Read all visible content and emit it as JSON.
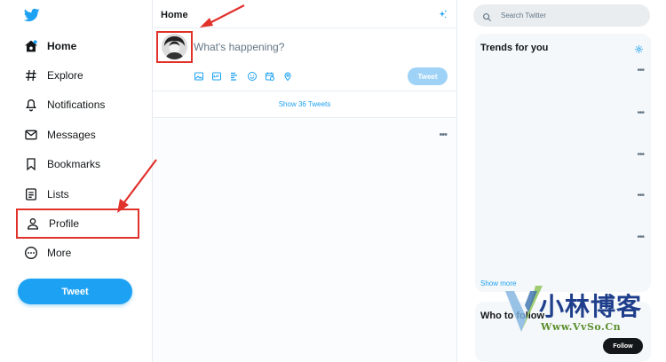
{
  "sidebar": {
    "logo": "twitter-bird-icon",
    "items": [
      {
        "label": "Home",
        "icon": "home-icon",
        "active": true
      },
      {
        "label": "Explore",
        "icon": "hashtag-icon",
        "active": false
      },
      {
        "label": "Notifications",
        "icon": "bell-icon",
        "active": false
      },
      {
        "label": "Messages",
        "icon": "envelope-icon",
        "active": false
      },
      {
        "label": "Bookmarks",
        "icon": "bookmark-icon",
        "active": false
      },
      {
        "label": "Lists",
        "icon": "list-icon",
        "active": false
      },
      {
        "label": "Profile",
        "icon": "person-icon",
        "active": false
      },
      {
        "label": "More",
        "icon": "more-circle-icon",
        "active": false
      }
    ],
    "tweet_button": "Tweet"
  },
  "main": {
    "title": "Home",
    "compose": {
      "placeholder": "What's happening?",
      "tweet_button": "Tweet"
    },
    "show_tweets": "Show 36 Tweets"
  },
  "right": {
    "search_placeholder": "Search Twitter",
    "trends_title": "Trends for you",
    "show_more": "Show more",
    "who_title": "Who to follow",
    "follow_button": "Follow"
  },
  "watermark": {
    "title": "小林博客",
    "url": "Www.VvSo.Cn"
  },
  "colors": {
    "brand": "#1da1f2",
    "highlight": "#e0312b",
    "text": "#14171a",
    "muted": "#657786"
  }
}
